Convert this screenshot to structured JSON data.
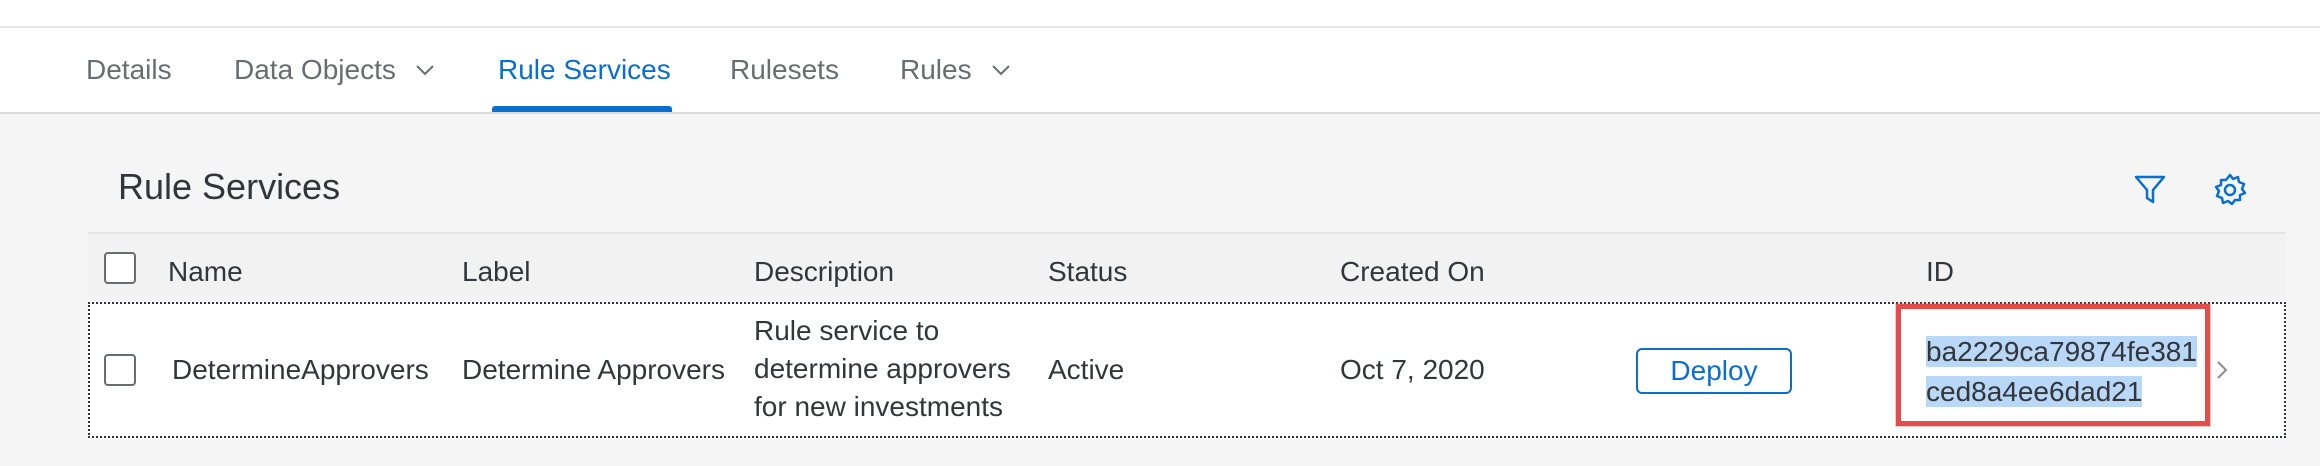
{
  "tabs": [
    {
      "label": "Details",
      "has_dropdown": false,
      "active": false
    },
    {
      "label": "Data Objects",
      "has_dropdown": true,
      "active": false
    },
    {
      "label": "Rule Services",
      "has_dropdown": false,
      "active": true
    },
    {
      "label": "Rulesets",
      "has_dropdown": false,
      "active": false
    },
    {
      "label": "Rules",
      "has_dropdown": true,
      "active": false
    }
  ],
  "section": {
    "title": "Rule Services",
    "icons": [
      "filter-icon",
      "settings-gear-icon"
    ]
  },
  "table": {
    "columns": [
      "Name",
      "Label",
      "Description",
      "Status",
      "Created On",
      "ID"
    ],
    "rows": [
      {
        "name": "DetermineApprovers",
        "label": "Determine Approvers",
        "description": [
          "Rule service to",
          "determine approvers",
          "for new investments"
        ],
        "status": "Active",
        "created_on": "Oct 7, 2020",
        "action_label": "Deploy",
        "id_lines": [
          "ba2229ca79874fe381",
          "ced8a4ee6dad21"
        ]
      }
    ]
  },
  "colors": {
    "accent": "#0a6ed1",
    "highlight_box": "#e34c4c",
    "selection": "#b9d7f7"
  }
}
